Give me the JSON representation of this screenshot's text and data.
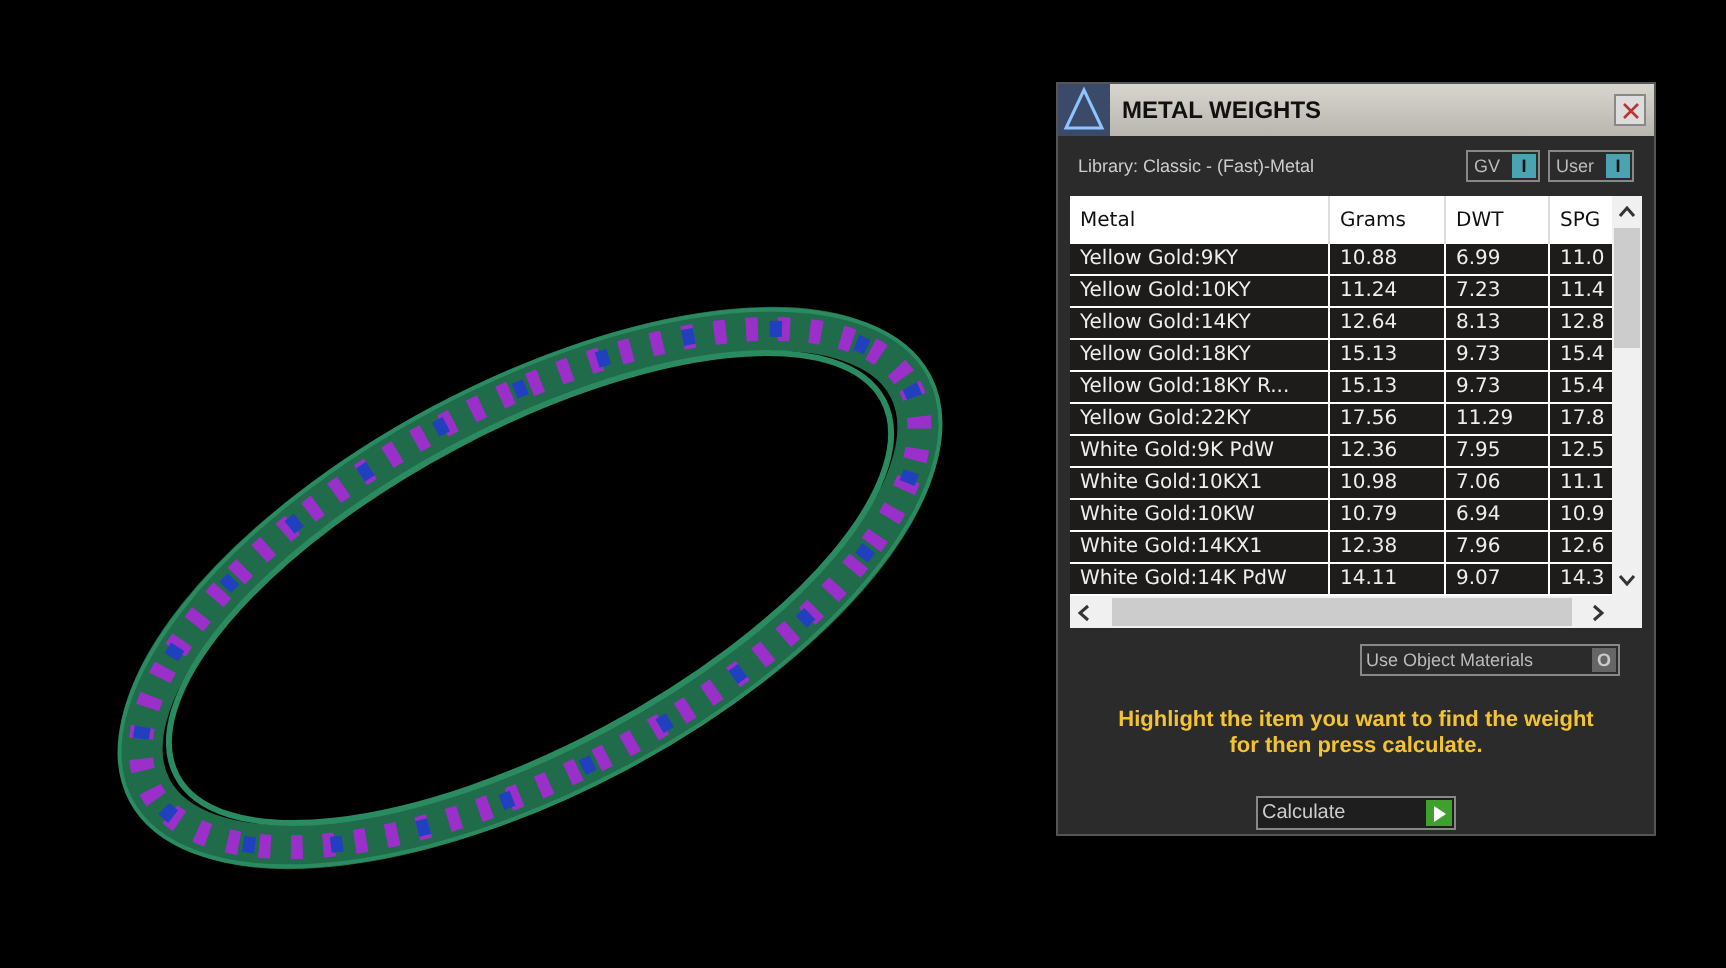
{
  "panel": {
    "title": "METAL WEIGHTS",
    "library": "Library: Classic - (Fast)-Metal",
    "toggles": [
      {
        "label": "GV",
        "on": true,
        "glyph": "I"
      },
      {
        "label": "User",
        "on": true,
        "glyph": "I"
      }
    ],
    "table": {
      "columns": [
        "Metal",
        "Grams",
        "DWT",
        "SPG"
      ],
      "rows": [
        [
          "Yellow Gold:9KY",
          "10.88",
          "6.99",
          "11.0"
        ],
        [
          "Yellow Gold:10KY",
          "11.24",
          "7.23",
          "11.4"
        ],
        [
          "Yellow Gold:14KY",
          "12.64",
          "8.13",
          "12.8"
        ],
        [
          "Yellow Gold:18KY",
          "15.13",
          "9.73",
          "15.4"
        ],
        [
          "Yellow Gold:18KY R...",
          "15.13",
          "9.73",
          "15.4"
        ],
        [
          "Yellow Gold:22KY",
          "17.56",
          "11.29",
          "17.8"
        ],
        [
          "White Gold:9K PdW",
          "12.36",
          "7.95",
          "12.5"
        ],
        [
          "White Gold:10KX1",
          "10.98",
          "7.06",
          "11.1"
        ],
        [
          "White Gold:10KW",
          "10.79",
          "6.94",
          "10.9"
        ],
        [
          "White Gold:14KX1",
          "12.38",
          "7.96",
          "12.6"
        ],
        [
          "White Gold:14K PdW",
          "14.11",
          "9.07",
          "14.3"
        ]
      ]
    },
    "use_object_materials": {
      "label": "Use Object Materials",
      "on": false,
      "glyph": "O"
    },
    "hint": "Highlight the item you want to find the weight for then press calculate.",
    "calculate": "Calculate"
  }
}
